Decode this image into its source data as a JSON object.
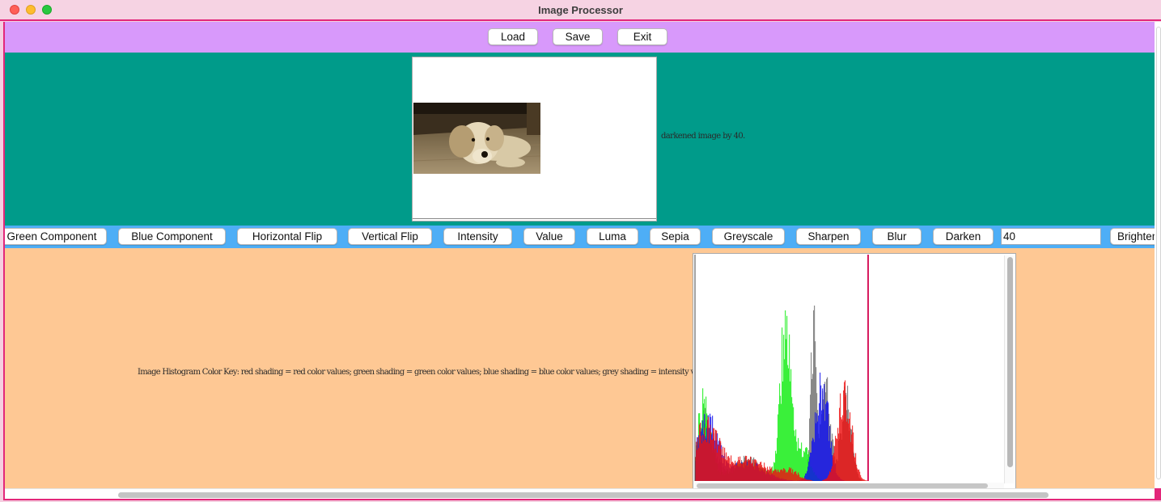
{
  "window": {
    "title": "Image Processor"
  },
  "topbar": {
    "load_label": "Load",
    "save_label": "Save",
    "exit_label": "Exit"
  },
  "image_panel": {
    "status_message": "darkened image by 40."
  },
  "ops": {
    "green_component": "Green Component",
    "blue_component": "Blue Component",
    "horizontal_flip": "Horizontal Flip",
    "vertical_flip": "Vertical Flip",
    "intensity": "Intensity",
    "value": "Value",
    "luma": "Luma",
    "sepia": "Sepia",
    "greyscale": "Greyscale",
    "sharpen": "Sharpen",
    "blur": "Blur",
    "darken": "Darken",
    "amount_value": "40",
    "brighten": "Brighten"
  },
  "histogram": {
    "color_key": "Image Histogram Color Key: red shading = red color values; green shading = green color values; blue shading = blue color values; grey shading = intensity values",
    "colors": {
      "red": "#ee1111",
      "green": "#11ee11",
      "blue": "#1111ee",
      "grey": "#777777",
      "marker": "#d81b60"
    }
  },
  "colors": {
    "topbar": "#d899fb",
    "image_panel": "#009b8a",
    "ops_bar": "#4eaef6",
    "histogram_panel": "#fec894",
    "frame_border": "#e3277a"
  }
}
